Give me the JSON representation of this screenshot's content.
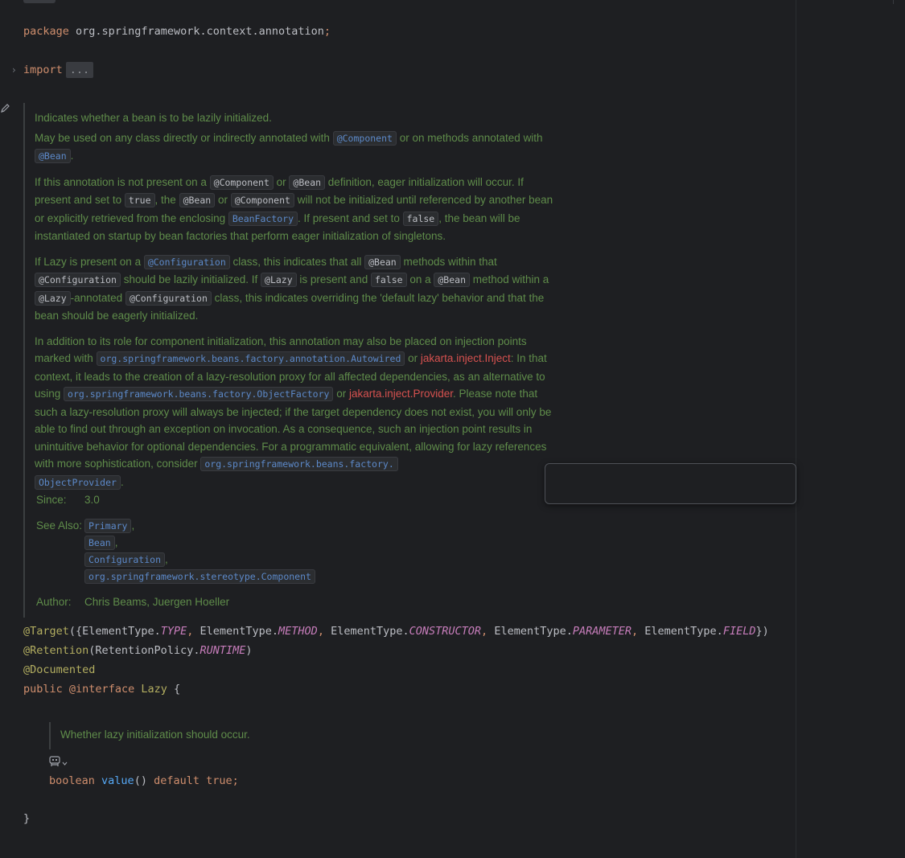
{
  "editor": {
    "package_kw": "package",
    "package_name": "org.springframework.context.annotation",
    "semicolon": ";",
    "import_kw": "import",
    "import_folded": "...",
    "fold_icon": "chevron-right-icon"
  },
  "javadoc": {
    "summary": "Indicates whether a bean is to be lazily initialized.",
    "p1": {
      "t1": "May be used on any class directly or indirectly annotated with ",
      "c1": "@Component",
      "t2": " or on methods annotated with ",
      "c2": "@Bean",
      "t3": "."
    },
    "p2": {
      "t1": "If this annotation is not present on a ",
      "c1": "@Component",
      "t2": " or ",
      "c2": "@Bean",
      "t3": " definition, eager initialization will occur. If present and set to ",
      "c3": "true",
      "t4": ", the ",
      "c4": "@Bean",
      "t5": " or ",
      "c5": "@Component",
      "t6": " will not be initialized until referenced by another bean or explicitly retrieved from the enclosing ",
      "c6": "BeanFactory",
      "t7": ". If present and set to ",
      "c7": "false",
      "t8": ", the bean will be instantiated on startup by bean factories that perform eager initialization of singletons."
    },
    "p3": {
      "t1": "If Lazy is present on a ",
      "c1": "@Configuration",
      "t2": " class, this indicates that all ",
      "c2": "@Bean",
      "t3": " methods within that ",
      "c3": "@Configuration",
      "t4": " should be lazily initialized. If ",
      "c4": "@Lazy",
      "t5": " is present and ",
      "c5": "false",
      "t6": " on a ",
      "c6": "@Bean",
      "t7": " method within a ",
      "c7": "@Lazy",
      "t8": "-annotated ",
      "c8": "@Configuration",
      "t9": " class, this indicates overriding the 'default lazy' behavior and that the bean should be eagerly initialized."
    },
    "p4": {
      "t1": "In addition to its role for component initialization, this annotation may also be placed on injection points marked with ",
      "c1": "org.springframework.beans.factory.annotation.Autowired",
      "t2": " or ",
      "x1": "jakarta.inject.Inject",
      "t3": ": In that context, it leads to the creation of a lazy-resolution proxy for all affected dependencies, as an alternative to using ",
      "c2": "org.springframework.beans.factory.ObjectFactory",
      "t4": " or ",
      "x2": "jakarta.inject.Provider",
      "t5": ". Please note that such a lazy-resolution proxy will always be injected; if the target dependency does not exist, you will only be able to find out through an exception on invocation. As a consequence, such an injection point results in unintuitive behavior for optional dependencies. For a programmatic equivalent, allowing for lazy references with more sophistication, consider ",
      "c3a": "org.springframework.beans.factory.",
      "c3b": "ObjectProvider",
      "t6": "."
    },
    "since_label": "Since:",
    "since_value": "3.0",
    "see_also_label": "See Also:",
    "see_also": [
      "Primary",
      "Bean",
      "Configuration",
      "org.springframework.stereotype.Component"
    ],
    "see_also_sep": ",",
    "author_label": "Author:",
    "author_value": "Chris Beams, Juergen Hoeller"
  },
  "code": {
    "target_ann": "@Target",
    "target_open": "({",
    "et": "ElementType.",
    "types": [
      "TYPE",
      "METHOD",
      "CONSTRUCTOR",
      "PARAMETER",
      "FIELD"
    ],
    "comma": ", ",
    "target_close": "})",
    "retention_ann": "@Retention",
    "retention_args_open": "(RetentionPolicy.",
    "retention_value": "RUNTIME",
    "paren_close": ")",
    "documented": "@Documented",
    "public_kw": "public",
    "interface_kw": "@interface",
    "type_name": "Lazy",
    "brace_open": "{",
    "method_doc": "Whether lazy initialization should occur.",
    "boolean_kw": "boolean",
    "method_name": "value",
    "method_parens": "()",
    "default_kw": "default",
    "true_kw": "true",
    "semicolon": ";",
    "brace_close": "}"
  },
  "icons": {
    "edit": "pencil-icon",
    "ai_assistant": "ai-assistant-icon",
    "dropdown": "chevron-down-icon"
  }
}
